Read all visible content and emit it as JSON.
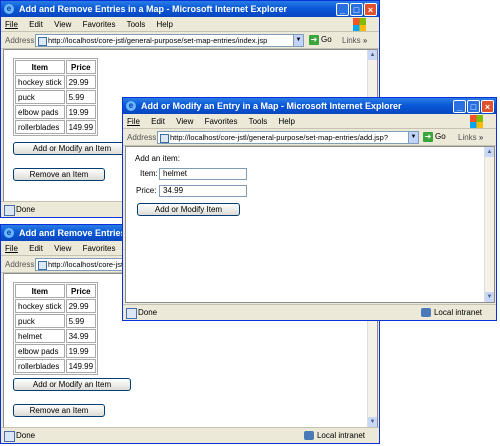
{
  "browser": {
    "menu": [
      "File",
      "Edit",
      "View",
      "Favorites",
      "Tools",
      "Help"
    ],
    "address_label": "Address",
    "go_label": "Go",
    "links_label": "Links",
    "links_chevron": "»",
    "scroll_up": "▲",
    "scroll_down": "▼",
    "dropdown_arrow": "▼",
    "title_controls": {
      "minimize": "_",
      "maximize": "□",
      "close": "×"
    }
  },
  "window_top": {
    "title": "Add and Remove Entries in a Map - Microsoft Internet Explorer",
    "url": "http://localhost/core-jstl/general-purpose/set-map-entries/index.jsp",
    "status": "Done",
    "table": {
      "headers": [
        "Item",
        "Price"
      ],
      "rows": [
        [
          "hockey stick",
          "29.99"
        ],
        [
          "puck",
          "5.99"
        ],
        [
          "elbow pads",
          "19.99"
        ],
        [
          "rollerblades",
          "149.99"
        ]
      ]
    },
    "add_modify_button": "Add or Modify an Item",
    "remove_button": "Remove an Item"
  },
  "window_dialog": {
    "title": "Add or Modify an Entry in a Map - Microsoft Internet Explorer",
    "url": "http://localhost/core-jstl/general-purpose/set-map-entries/add.jsp?",
    "heading": "Add an item:",
    "item_label": "Item:",
    "item_value": "helmet",
    "price_label": "Price:",
    "price_value": "34.99",
    "submit_button": "Add or Modify Item",
    "status": "Done",
    "zone": "Local intranet"
  },
  "window_bottom": {
    "title": "Add and Remove Entries in a Map - Microsoft Internet Explorer",
    "url": "http://localhost/core-jstl/",
    "status": "Done",
    "zone": "Local intranet",
    "table": {
      "headers": [
        "Item",
        "Price"
      ],
      "rows": [
        [
          "hockey stick",
          "29.99"
        ],
        [
          "puck",
          "5.99"
        ],
        [
          "helmet",
          "34.99"
        ],
        [
          "elbow pads",
          "19.99"
        ],
        [
          "rollerblades",
          "149.99"
        ]
      ]
    },
    "add_modify_button": "Add or Modify an Item",
    "remove_button": "Remove an Item"
  }
}
